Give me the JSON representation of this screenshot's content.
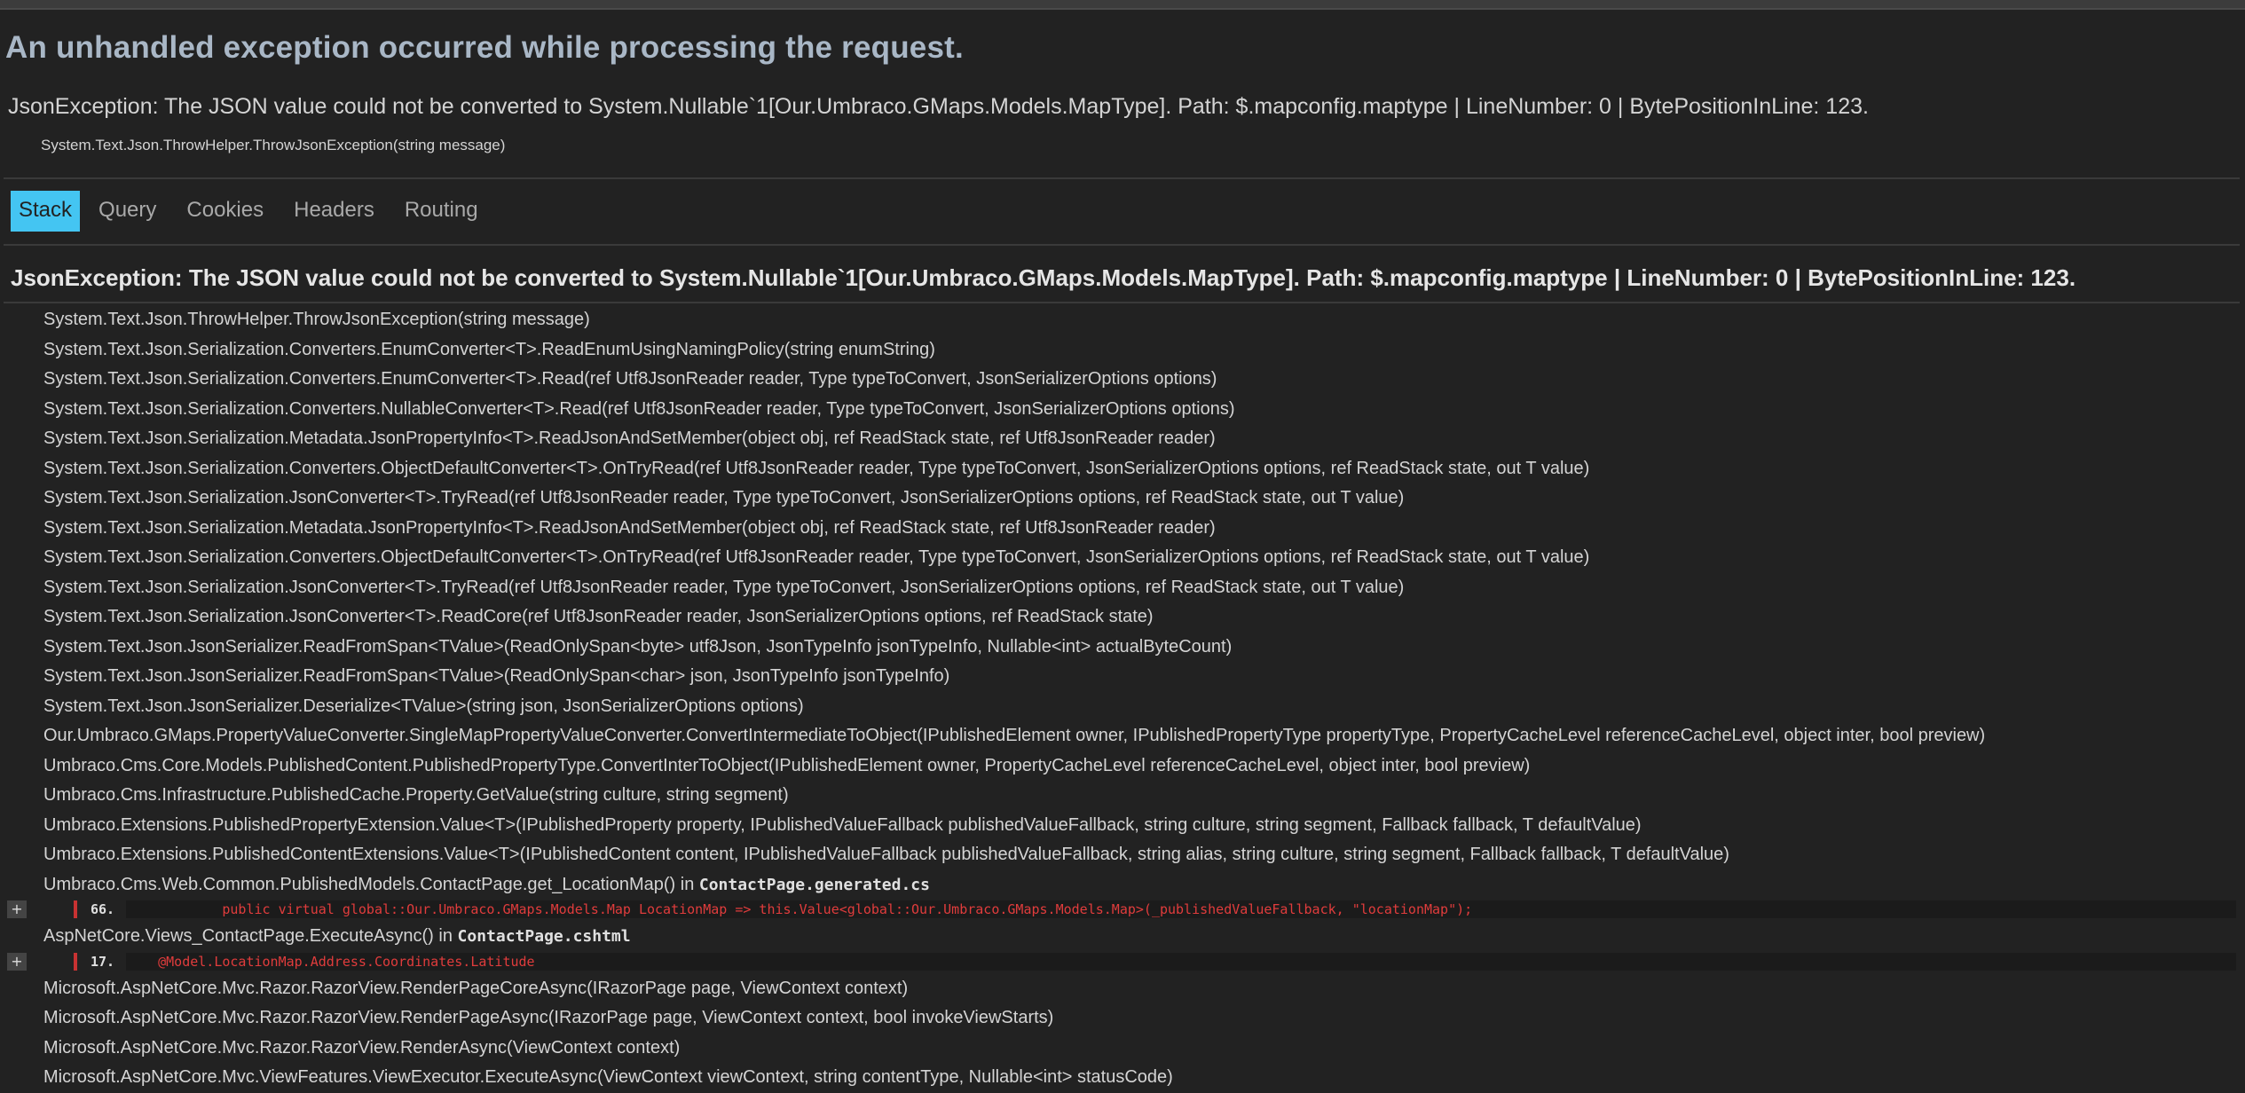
{
  "page": {
    "title": "An unhandled exception occurred while processing the request.",
    "error_message": "JsonException: The JSON value could not be converted to System.Nullable`1[Our.Umbraco.GMaps.Models.MapType]. Path: $.mapconfig.maptype | LineNumber: 0 | BytePositionInLine: 123.",
    "error_location": "System.Text.Json.ThrowHelper.ThrowJsonException(string message)"
  },
  "tabs": [
    {
      "label": "Stack",
      "active": true
    },
    {
      "label": "Query",
      "active": false
    },
    {
      "label": "Cookies",
      "active": false
    },
    {
      "label": "Headers",
      "active": false
    },
    {
      "label": "Routing",
      "active": false
    }
  ],
  "stack": {
    "exception_title": "JsonException: The JSON value could not be converted to System.Nullable`1[Our.Umbraco.GMaps.Models.MapType]. Path: $.mapconfig.maptype | LineNumber: 0 | BytePositionInLine: 123.",
    "frames": [
      "System.Text.Json.ThrowHelper.ThrowJsonException(string message)",
      "System.Text.Json.Serialization.Converters.EnumConverter<T>.ReadEnumUsingNamingPolicy(string enumString)",
      "System.Text.Json.Serialization.Converters.EnumConverter<T>.Read(ref Utf8JsonReader reader, Type typeToConvert, JsonSerializerOptions options)",
      "System.Text.Json.Serialization.Converters.NullableConverter<T>.Read(ref Utf8JsonReader reader, Type typeToConvert, JsonSerializerOptions options)",
      "System.Text.Json.Serialization.Metadata.JsonPropertyInfo<T>.ReadJsonAndSetMember(object obj, ref ReadStack state, ref Utf8JsonReader reader)",
      "System.Text.Json.Serialization.Converters.ObjectDefaultConverter<T>.OnTryRead(ref Utf8JsonReader reader, Type typeToConvert, JsonSerializerOptions options, ref ReadStack state, out T value)",
      "System.Text.Json.Serialization.JsonConverter<T>.TryRead(ref Utf8JsonReader reader, Type typeToConvert, JsonSerializerOptions options, ref ReadStack state, out T value)",
      "System.Text.Json.Serialization.Metadata.JsonPropertyInfo<T>.ReadJsonAndSetMember(object obj, ref ReadStack state, ref Utf8JsonReader reader)",
      "System.Text.Json.Serialization.Converters.ObjectDefaultConverter<T>.OnTryRead(ref Utf8JsonReader reader, Type typeToConvert, JsonSerializerOptions options, ref ReadStack state, out T value)",
      "System.Text.Json.Serialization.JsonConverter<T>.TryRead(ref Utf8JsonReader reader, Type typeToConvert, JsonSerializerOptions options, ref ReadStack state, out T value)",
      "System.Text.Json.Serialization.JsonConverter<T>.ReadCore(ref Utf8JsonReader reader, JsonSerializerOptions options, ref ReadStack state)",
      "System.Text.Json.JsonSerializer.ReadFromSpan<TValue>(ReadOnlySpan<byte> utf8Json, JsonTypeInfo jsonTypeInfo, Nullable<int> actualByteCount)",
      "System.Text.Json.JsonSerializer.ReadFromSpan<TValue>(ReadOnlySpan<char> json, JsonTypeInfo jsonTypeInfo)",
      "System.Text.Json.JsonSerializer.Deserialize<TValue>(string json, JsonSerializerOptions options)",
      "Our.Umbraco.GMaps.PropertyValueConverter.SingleMapPropertyValueConverter.ConvertIntermediateToObject(IPublishedElement owner, IPublishedPropertyType propertyType, PropertyCacheLevel referenceCacheLevel, object inter, bool preview)",
      "Umbraco.Cms.Core.Models.PublishedContent.PublishedPropertyType.ConvertInterToObject(IPublishedElement owner, PropertyCacheLevel referenceCacheLevel, object inter, bool preview)",
      "Umbraco.Cms.Infrastructure.PublishedCache.Property.GetValue(string culture, string segment)",
      "Umbraco.Extensions.PublishedPropertyExtension.Value<T>(IPublishedProperty property, IPublishedValueFallback publishedValueFallback, string culture, string segment, Fallback fallback, T defaultValue)",
      "Umbraco.Extensions.PublishedContentExtensions.Value<T>(IPublishedContent content, IPublishedValueFallback publishedValueFallback, string alias, string culture, string segment, Fallback fallback, T defaultValue)"
    ],
    "source_frames": [
      {
        "method": "Umbraco.Cms.Web.Common.PublishedModels.ContactPage.get_LocationMap() in ",
        "file": "ContactPage.generated.cs",
        "expand_label": "+",
        "line_number": "66.",
        "code": "            public virtual global::Our.Umbraco.GMaps.Models.Map LocationMap => this.Value<global::Our.Umbraco.GMaps.Models.Map>(_publishedValueFallback, \"locationMap\");"
      },
      {
        "method": "AspNetCore.Views_ContactPage.ExecuteAsync() in ",
        "file": "ContactPage.cshtml",
        "expand_label": "+",
        "line_number": "17.",
        "code": "    @Model.LocationMap.Address.Coordinates.Latitude"
      }
    ],
    "trailing_frames": [
      "Microsoft.AspNetCore.Mvc.Razor.RazorView.RenderPageCoreAsync(IRazorPage page, ViewContext context)",
      "Microsoft.AspNetCore.Mvc.Razor.RazorView.RenderPageAsync(IRazorPage page, ViewContext context, bool invokeViewStarts)",
      "Microsoft.AspNetCore.Mvc.Razor.RazorView.RenderAsync(ViewContext context)",
      "Microsoft.AspNetCore.Mvc.ViewFeatures.ViewExecutor.ExecuteAsync(ViewContext viewContext, string contentType, Nullable<int> statusCode)"
    ]
  },
  "colors": {
    "background": "#222222",
    "title": "#a9b7c6",
    "active_tab": "#44c5f2",
    "error_code": "#e03c3c",
    "error_marker": "#c83232"
  }
}
